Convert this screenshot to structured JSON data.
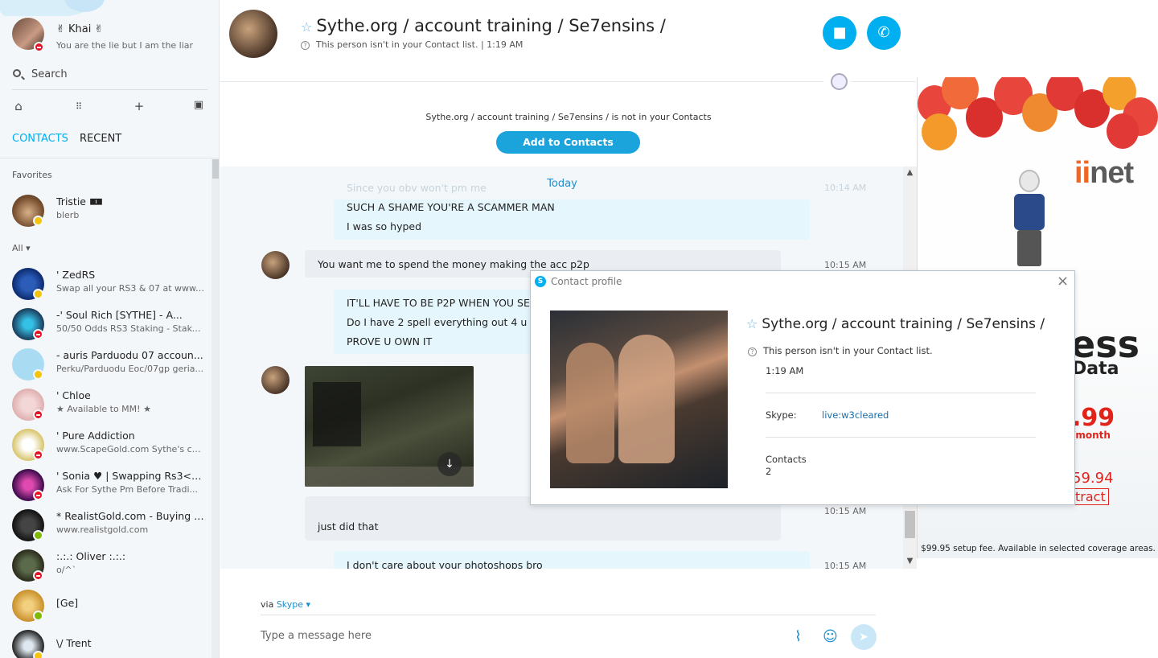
{
  "profile": {
    "name": "✌ Khai ✌",
    "mood": "You are the lie but I am the liar",
    "status": "do-not-disturb"
  },
  "search": {
    "placeholder": "Search"
  },
  "toolbar": {
    "icons": [
      "home-icon",
      "dialpad-icon",
      "plus-icon",
      "bot-icon"
    ]
  },
  "tabs": {
    "contacts": "CONTACTS",
    "recent": "RECENT"
  },
  "sections": {
    "favorites": "Favorites",
    "all": "All ▾"
  },
  "favorites": [
    {
      "name": "Tristie 🀰",
      "mood": "blerb",
      "status": "away"
    }
  ],
  "contacts": [
    {
      "name": "'                      ZedRS",
      "mood": "Swap all your RS3 & 07 at www....",
      "status": "away"
    },
    {
      "name": "-'     Soul Rich [SYTHE] - A...",
      "mood": "50/50 Odds RS3 Staking - Stake...",
      "status": "dnd"
    },
    {
      "name": "-     auris Parduodu 07 accoun...",
      "mood": "Perku/Parduodu Eoc/07gp geria...",
      "status": "away"
    },
    {
      "name": "' Chloe",
      "mood": "★ Available to MM! ★",
      "status": "dnd"
    },
    {
      "name": "' Pure Addiction",
      "mood": "www.ScapeGold.com Sythe's ch...",
      "status": "dnd"
    },
    {
      "name": "' Sonia ♥ | Swapping Rs3<->...",
      "mood": "Ask For Sythe Pm Before Tradi...",
      "status": "dnd"
    },
    {
      "name": "* RealistGold.com - Buying &...",
      "mood": "www.realistgold.com",
      "status": "online"
    },
    {
      "name": ":.:.: Oliver :.:.:",
      "mood": "o/^`",
      "status": "dnd"
    },
    {
      "name": "[Ge]",
      "mood": "",
      "status": "online"
    },
    {
      "name": "\\/ Trent",
      "mood": "",
      "status": "away"
    }
  ],
  "chat": {
    "title": "Sythe.org / account training / Se7ensins /",
    "subtitle": "This person isn't in your Contact list.  |  1:19 AM",
    "notice": "Sythe.org / account training / Se7ensins / is not in your Contacts",
    "add_button": "Add to Contacts",
    "today": "Today",
    "messages": {
      "faded": "Since you obv won't pm me",
      "faded_time": "10:14 AM",
      "m1a": "SUCH A SHAME YOU'RE A SCAMMER MAN",
      "m1b": "I was so hyped",
      "m2": "You want me to spend the money making the acc p2p",
      "m2_time": "10:15 AM",
      "m3a": "IT'LL HAVE TO BE P2P WHEN YOU SELL",
      "m3b": "Do I have 2 spell everything out 4 u",
      "m3c": "PROVE U OWN IT",
      "m4": "just did that",
      "m4_time": "10:15 AM",
      "m5": "I don't care about your photoshops bro",
      "m5_time": "10:15 AM"
    },
    "via_label": "via",
    "via_service": "Skype ▾",
    "compose_placeholder": "Type a message here"
  },
  "ad": {
    "brand_i": "ii",
    "brand_rest": "net",
    "headline": "ess",
    "data": "Data",
    "price": ".99",
    "per_month": "/month",
    "old_price": "59.94",
    "contract": "tract",
    "footer": "$99.95 setup fee. Available in selected coverage areas."
  },
  "popup": {
    "title": "Contact profile",
    "name": "Sythe.org / account training / Se7ensins /",
    "note": "This person isn't in your Contact list.",
    "time": "1:19 AM",
    "skype_label": "Skype:",
    "skype_value": "live:w3cleared",
    "contacts_label": "Contacts",
    "contacts_value": "2"
  }
}
